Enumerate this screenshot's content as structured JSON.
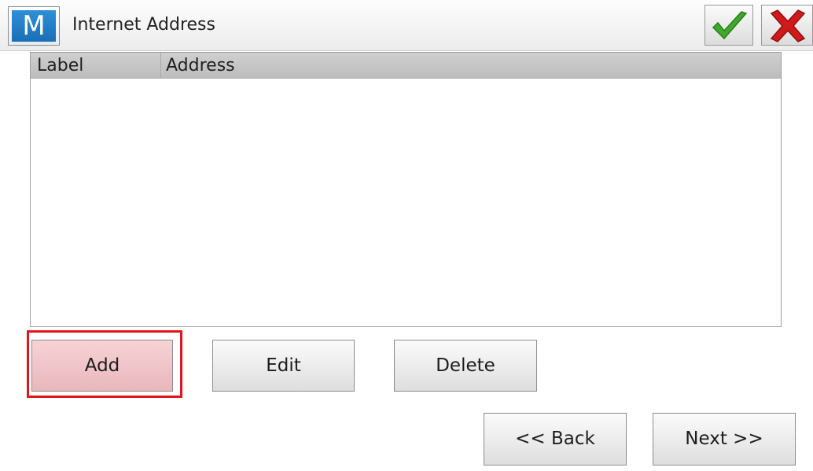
{
  "window": {
    "app_logo_letter": "M",
    "title": "Internet Address",
    "ok_icon": "checkmark-icon",
    "cancel_icon": "close-x-icon"
  },
  "list": {
    "columns": [
      "Label",
      "Address"
    ],
    "rows": []
  },
  "actions": {
    "add_label": "Add",
    "edit_label": "Edit",
    "delete_label": "Delete"
  },
  "navigation": {
    "back_label": "<< Back",
    "next_label": "Next >>"
  },
  "colors": {
    "highlight_outline": "#e2141c",
    "ok_green": "#3faa2a",
    "cancel_red": "#d01a1a",
    "logo_blue": "#1a6fb6"
  }
}
